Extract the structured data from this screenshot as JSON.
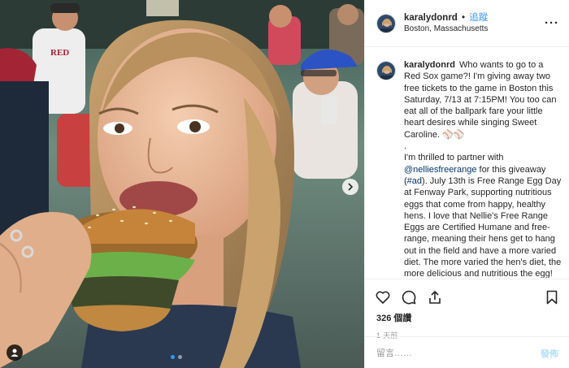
{
  "post": {
    "username": "karalydonrd",
    "separator": "•",
    "follow_label": "追蹤",
    "location": "Boston, Massachusetts",
    "more_icon": "more-dots-icon"
  },
  "caption": {
    "username": "karalydonrd",
    "part1": "Who wants to go to a Red Sox game?! I'm giving away two free tickets to the game in Boston this Saturday, 7/13 at 7:15PM! You too can eat all of the ballpark fare your little heart desires while singing Sweet Caroline. ⚾⚾",
    "dot": ".",
    "part2_pre": "I'm thrilled to partner with ",
    "mention": "@nelliesfreerange",
    "part2_mid": " for this giveaway (",
    "hashtag": "#ad",
    "part2_post": "). July 13th is Free Range Egg Day at Fenway Park, supporting nutritious eggs that come from happy, healthy hens. I love that Nellie's Free Range Eggs are Certified Humane and free-range, meaning their hens get to hang out in the field and have a more varied diet. The more varied the hen's diet, the more delicious and nutritious the egg!"
  },
  "actions": {
    "likes": "326 個讚",
    "time": "1 天前",
    "icons": [
      "heart-icon",
      "comment-icon",
      "share-icon",
      "bookmark-icon"
    ]
  },
  "comment_box": {
    "placeholder": "留言……",
    "post_label": "發佈"
  },
  "carousel": {
    "slides": 2,
    "active_index": 0
  },
  "colors": {
    "link": "#3897f0",
    "mention": "#003569",
    "post_disabled": "#b2dffc"
  }
}
